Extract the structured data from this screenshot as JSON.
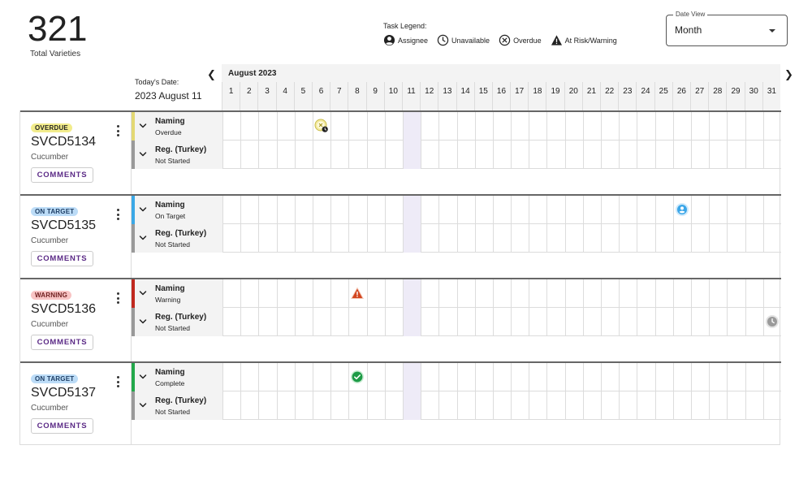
{
  "summary": {
    "count": "321",
    "label": "Total Varieties"
  },
  "legend": {
    "title": "Task Legend:",
    "items": [
      {
        "label": "Assignee",
        "icon": "assignee-icon"
      },
      {
        "label": "Unavailable",
        "icon": "clock-icon"
      },
      {
        "label": "Overdue",
        "icon": "circle-x-icon"
      },
      {
        "label": "At Risk/Warning",
        "icon": "warning-triangle-icon"
      }
    ]
  },
  "date_view": {
    "label": "Date View",
    "value": "Month"
  },
  "today": {
    "label": "Today's Date:",
    "value": "2023 August 11"
  },
  "calendar": {
    "month": "August 2023",
    "days": [
      "1",
      "2",
      "3",
      "4",
      "5",
      "6",
      "7",
      "8",
      "9",
      "10",
      "11",
      "12",
      "13",
      "14",
      "15",
      "16",
      "17",
      "18",
      "19",
      "20",
      "21",
      "22",
      "23",
      "24",
      "25",
      "26",
      "27",
      "28",
      "29",
      "30",
      "31"
    ],
    "today_day": 11
  },
  "varieties": [
    {
      "status": "OVERDUE",
      "status_bg": "#f2ec8c",
      "status_fg": "#222222",
      "id": "SVCD5134",
      "type": "Cucumber",
      "comments_label": "COMMENTS",
      "tasks": [
        {
          "name": "Naming",
          "status": "Overdue",
          "bar_color": "#e3d873"
        },
        {
          "name": "Reg. (Turkey)",
          "status": "Not Started",
          "bar_color": "#999999"
        }
      ]
    },
    {
      "status": "ON TARGET",
      "status_bg": "#bcdcf7",
      "status_fg": "#1f3f66",
      "id": "SVCD5135",
      "type": "Cucumber",
      "comments_label": "COMMENTS",
      "tasks": [
        {
          "name": "Naming",
          "status": "On Target",
          "bar_color": "#3ba8e6"
        },
        {
          "name": "Reg. (Turkey)",
          "status": "Not Started",
          "bar_color": "#999999"
        }
      ]
    },
    {
      "status": "WARNING",
      "status_bg": "#f8c4c4",
      "status_fg": "#6e1d1d",
      "id": "SVCD5136",
      "type": "Cucumber",
      "comments_label": "COMMENTS",
      "tasks": [
        {
          "name": "Naming",
          "status": "Warning",
          "bar_color": "#c0281e"
        },
        {
          "name": "Reg. (Turkey)",
          "status": "Not Started",
          "bar_color": "#999999"
        }
      ]
    },
    {
      "status": "ON TARGET",
      "status_bg": "#bcdcf7",
      "status_fg": "#1f3f66",
      "id": "SVCD5137",
      "type": "Cucumber",
      "comments_label": "COMMENTS",
      "tasks": [
        {
          "name": "Naming",
          "status": "Complete",
          "bar_color": "#22a84a"
        },
        {
          "name": "Reg. (Turkey)",
          "status": "Not Started",
          "bar_color": "#999999"
        }
      ]
    }
  ],
  "markers": [
    {
      "variety": 0,
      "task": 0,
      "day": 6,
      "icon": "overdue-clock-icon"
    },
    {
      "variety": 1,
      "task": 0,
      "day": 26,
      "icon": "assignee-icon"
    },
    {
      "variety": 2,
      "task": 0,
      "day": 8,
      "icon": "warning-triangle-icon"
    },
    {
      "variety": 2,
      "task": 1,
      "day": 31,
      "icon": "clock-icon"
    },
    {
      "variety": 3,
      "task": 0,
      "day": 8,
      "icon": "check-circle-icon"
    }
  ]
}
